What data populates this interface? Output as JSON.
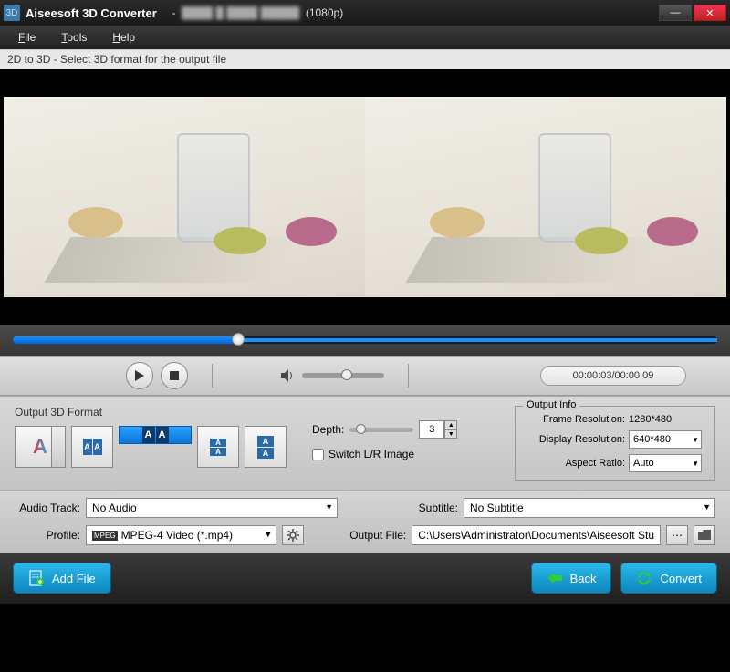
{
  "titlebar": {
    "app_name": "Aiseesoft 3D Converter",
    "file_info": "(1080p)"
  },
  "menu": {
    "file": "File",
    "tools": "Tools",
    "help": "Help"
  },
  "infobar": {
    "text": "2D to 3D - Select 3D format for the output file"
  },
  "player": {
    "time_display": "00:00:03/00:00:09",
    "progress_pct": 32,
    "volume_pct": 48
  },
  "format_panel": {
    "title": "Output 3D Format",
    "anaglyph_label": "A",
    "depth_label": "Depth:",
    "depth_value": "3",
    "switch_label": "Switch L/R Image",
    "switch_checked": false
  },
  "output_info": {
    "legend": "Output Info",
    "frame_res_label": "Frame Resolution:",
    "frame_res_value": "1280*480",
    "display_res_label": "Display Resolution:",
    "display_res_value": "640*480",
    "aspect_label": "Aspect Ratio:",
    "aspect_value": "Auto"
  },
  "settings": {
    "audio_track_label": "Audio Track:",
    "audio_track_value": "No Audio",
    "subtitle_label": "Subtitle:",
    "subtitle_value": "No Subtitle",
    "profile_label": "Profile:",
    "profile_value": "MPEG-4 Video (*.mp4)",
    "output_file_label": "Output File:",
    "output_file_value": "C:\\Users\\Administrator\\Documents\\Aiseesoft Stu"
  },
  "buttons": {
    "add_file": "Add File",
    "back": "Back",
    "convert": "Convert"
  }
}
